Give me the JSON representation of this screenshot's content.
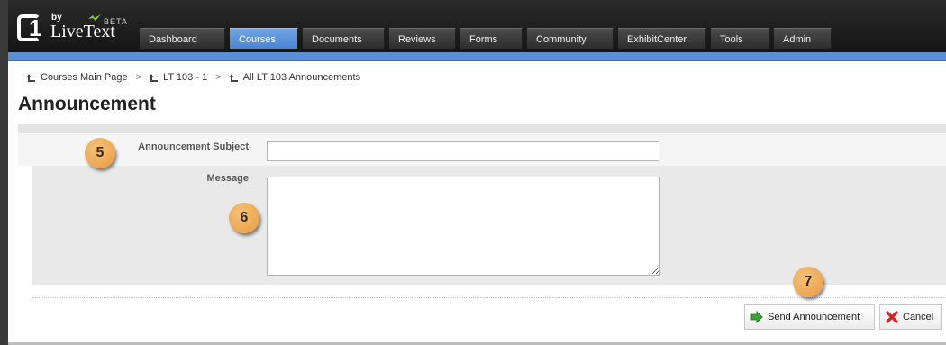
{
  "app": {
    "logo_by": "by",
    "logo_name": "LiveText",
    "logo_badge": "BETA",
    "logo_mark": "1"
  },
  "nav": {
    "tabs": [
      {
        "label": "Dashboard"
      },
      {
        "label": "Courses"
      },
      {
        "label": "Documents"
      },
      {
        "label": "Reviews"
      },
      {
        "label": "Forms"
      },
      {
        "label": "Community"
      },
      {
        "label": "ExhibitCenter"
      },
      {
        "label": "Tools"
      },
      {
        "label": "Admin"
      }
    ],
    "active_tab": "Courses"
  },
  "breadcrumb": {
    "items": [
      {
        "label": "Courses Main Page"
      },
      {
        "label": "LT 103 - 1"
      },
      {
        "label": "All LT 103 Announcements"
      }
    ],
    "separator": ">"
  },
  "page": {
    "title": "Announcement"
  },
  "form": {
    "subject_label": "Announcement Subject",
    "subject_value": "",
    "message_label": "Message",
    "message_value": ""
  },
  "actions": {
    "send_label": "Send Announcement",
    "cancel_label": "Cancel"
  },
  "callouts": {
    "c5": "5",
    "c6": "6",
    "c7": "7"
  },
  "colors": {
    "accent_blue": "#5a8fd6",
    "callout_orange": "#e79a3e",
    "header_dark": "#1f1f1f"
  }
}
